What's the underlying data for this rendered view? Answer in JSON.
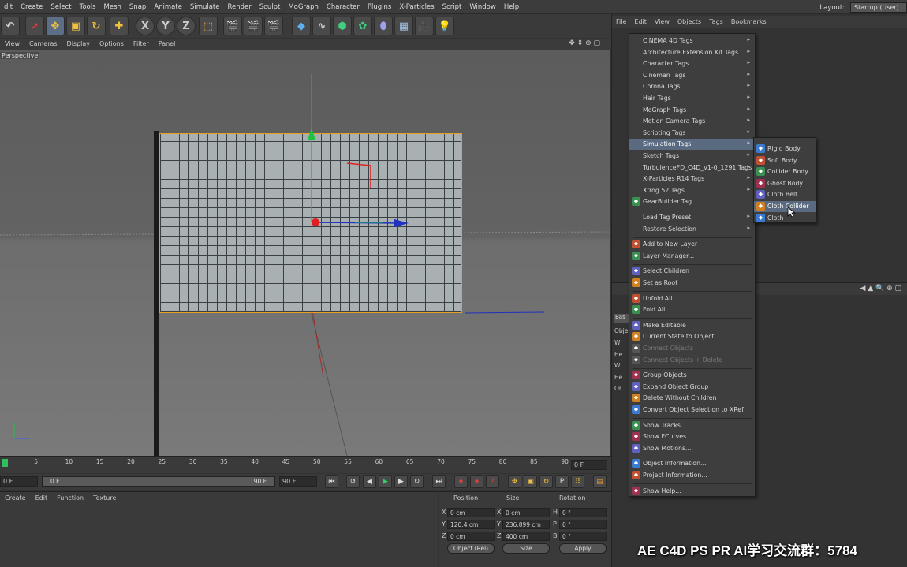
{
  "menubar": {
    "items": [
      "dit",
      "Create",
      "Select",
      "Tools",
      "Mesh",
      "Snap",
      "Animate",
      "Simulate",
      "Render",
      "Sculpt",
      "MoGraph",
      "Character",
      "Plugins",
      "X-Particles",
      "Script",
      "Window",
      "Help"
    ],
    "layout_label": "Layout:",
    "layout_value": "Startup (User)"
  },
  "toolbar": {
    "icons": [
      "undo-icon",
      "live-select-icon",
      "move-icon",
      "scale-icon",
      "rotate-icon",
      "last-tool-icon",
      "x-axis-icon",
      "y-axis-icon",
      "z-axis-icon",
      "world-coordinates-icon",
      "render-view-icon",
      "render-picture-viewer-icon",
      "render-settings-icon",
      "cube-icon",
      "spline-icon",
      "subdivision-icon",
      "cloner-icon",
      "deformer-icon",
      "floor-icon",
      "camera-icon",
      "light-icon"
    ],
    "x_label": "X",
    "y_label": "Y",
    "z_label": "Z"
  },
  "viewport": {
    "menu": [
      "View",
      "Cameras",
      "Display",
      "Options",
      "Filter",
      "Panel"
    ],
    "label": "Perspective"
  },
  "timeline": {
    "ticks": [
      "0",
      "5",
      "10",
      "15",
      "20",
      "25",
      "30",
      "35",
      "40",
      "45",
      "50",
      "55",
      "60",
      "65",
      "70",
      "75",
      "80",
      "85",
      "90"
    ],
    "current_frame": "0 F",
    "start_field": "0 F",
    "range_start": "0 F",
    "range_end": "90 F",
    "end_field": "90 F"
  },
  "bottom_left": {
    "menu": [
      "Create",
      "Edit",
      "Function",
      "Texture"
    ]
  },
  "coordinates": {
    "position_header": "Position",
    "size_header": "Size",
    "rotation_header": "Rotation",
    "rows": [
      {
        "axis": "X",
        "pos": "0 cm",
        "size_axis": "X",
        "size": "0 cm",
        "rot_axis": "H",
        "rot": "0 °"
      },
      {
        "axis": "Y",
        "pos": "120.4 cm",
        "size_axis": "Y",
        "size": "236.899 cm",
        "rot_axis": "P",
        "rot": "0 °"
      },
      {
        "axis": "Z",
        "pos": "0 cm",
        "size_axis": "Z",
        "size": "400 cm",
        "rot_axis": "B",
        "rot": "0 °"
      }
    ],
    "mode": "Object (Rel)",
    "size_mode": "Size",
    "apply": "Apply"
  },
  "object_manager": {
    "menu": [
      "File",
      "Edit",
      "View",
      "Objects",
      "Tags",
      "Bookmarks"
    ]
  },
  "attributes": {
    "tab": "Bas",
    "obj_label": "Obje",
    "rows": [
      "W",
      "He",
      "W",
      "He",
      "Or"
    ]
  },
  "context_menu": {
    "items": [
      {
        "label": "CINEMA 4D Tags",
        "sub": true
      },
      {
        "label": "Architecture Extension Kit Tags",
        "sub": true
      },
      {
        "label": "Character Tags",
        "sub": true
      },
      {
        "label": "Cineman Tags",
        "sub": true
      },
      {
        "label": "Corona Tags",
        "sub": true
      },
      {
        "label": "Hair Tags",
        "sub": true
      },
      {
        "label": "MoGraph Tags",
        "sub": true
      },
      {
        "label": "Motion Camera Tags",
        "sub": true
      },
      {
        "label": "Scripting Tags",
        "sub": true
      },
      {
        "label": "Simulation Tags",
        "sub": true,
        "highlight": true
      },
      {
        "label": "Sketch Tags",
        "sub": true
      },
      {
        "label": "TurbulenceFD_C4D_v1-0_1291 Tags",
        "sub": true
      },
      {
        "label": "X-Particles R14 Tags",
        "sub": true
      },
      {
        "label": "Xfrog 52 Tags",
        "sub": true
      },
      {
        "label": "GearBuilder Tag",
        "icon": "gear-tag-icon"
      },
      {
        "sep": true
      },
      {
        "label": "Load Tag Preset",
        "sub": true
      },
      {
        "label": "Restore Selection",
        "sub": true
      },
      {
        "sep": true
      },
      {
        "label": "Add to New Layer",
        "icon": "layer-add-icon"
      },
      {
        "label": "Layer Manager...",
        "icon": "layer-manager-icon"
      },
      {
        "sep": true
      },
      {
        "label": "Select Children",
        "icon": "select-children-icon"
      },
      {
        "label": "Set as Root",
        "icon": "set-root-icon"
      },
      {
        "sep": true
      },
      {
        "label": "Unfold All",
        "icon": "unfold-icon"
      },
      {
        "label": "Fold All",
        "icon": "fold-icon"
      },
      {
        "sep": true
      },
      {
        "label": "Make Editable",
        "icon": "make-editable-icon"
      },
      {
        "label": "Current State to Object",
        "icon": "current-state-icon"
      },
      {
        "label": "Connect Objects",
        "icon": "connect-icon",
        "disabled": true
      },
      {
        "label": "Connect Objects + Delete",
        "icon": "connect-delete-icon",
        "disabled": true
      },
      {
        "sep": true
      },
      {
        "label": "Group Objects",
        "icon": "group-icon"
      },
      {
        "label": "Expand Object Group",
        "icon": "expand-group-icon"
      },
      {
        "label": "Delete Without Children",
        "icon": "delete-icon"
      },
      {
        "label": "Convert Object Selection to XRef",
        "icon": "xref-icon"
      },
      {
        "sep": true
      },
      {
        "label": "Show Tracks...",
        "icon": "tracks-icon"
      },
      {
        "label": "Show FCurves...",
        "icon": "fcurves-icon"
      },
      {
        "label": "Show Motions...",
        "icon": "motions-icon"
      },
      {
        "sep": true
      },
      {
        "label": "Object Information...",
        "icon": "info-icon"
      },
      {
        "label": "Project Information...",
        "icon": "project-info-icon"
      },
      {
        "sep": true
      },
      {
        "label": "Show Help...",
        "icon": "help-icon"
      }
    ]
  },
  "submenu": {
    "items": [
      {
        "label": "Rigid Body",
        "icon": "rigid-body-icon"
      },
      {
        "label": "Soft Body",
        "icon": "soft-body-icon"
      },
      {
        "label": "Collider Body",
        "icon": "collider-body-icon"
      },
      {
        "label": "Ghost Body",
        "icon": "ghost-body-icon"
      },
      {
        "label": "Cloth Belt",
        "icon": "cloth-belt-icon"
      },
      {
        "label": "Cloth Collider",
        "icon": "cloth-collider-icon",
        "highlight": true
      },
      {
        "label": "Cloth",
        "icon": "cloth-icon"
      }
    ]
  },
  "watermark": "AE C4D PS PR AI学习交流群：5784",
  "colors": {
    "selection": "#e8a020",
    "highlight": "#5a6a80",
    "axis_x": "#2030c0",
    "axis_y": "#20c040",
    "axis_z": "#c03030"
  }
}
